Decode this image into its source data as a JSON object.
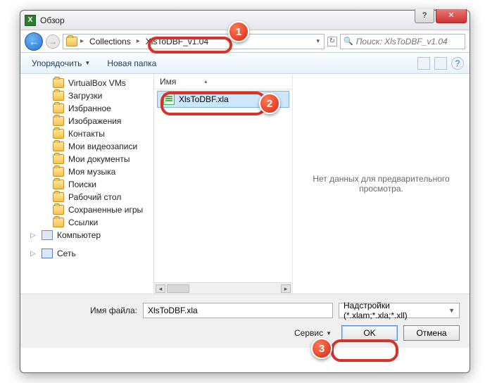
{
  "window": {
    "title": "Обзор"
  },
  "nav": {
    "crumb1": "Collections",
    "crumb2": "XlsToDBF_v1.04",
    "search_placeholder": "Поиск: XlsToDBF_v1.04"
  },
  "toolbar": {
    "organize": "Упорядочить",
    "newfolder": "Новая папка"
  },
  "sidebar": {
    "items": [
      "VirtualBox VMs",
      "Загрузки",
      "Избранное",
      "Изображения",
      "Контакты",
      "Мои видеозаписи",
      "Мои документы",
      "Моя музыка",
      "Поиски",
      "Рабочий стол",
      "Сохраненные игры",
      "Ссылки"
    ],
    "computer": "Компьютер",
    "network": "Сеть"
  },
  "filelist": {
    "col_name": "Имя",
    "file1": "XlsToDBF.xla"
  },
  "preview": {
    "text": "Нет данных для предварительного просмотра."
  },
  "footer": {
    "filename_label": "Имя файла:",
    "filename_value": "XlsToDBF.xla",
    "filter": "Надстройки (*.xlam;*.xla;*.xll)",
    "service": "Сервис",
    "ok": "OK",
    "cancel": "Отмена"
  },
  "callouts": {
    "c1": "1",
    "c2": "2",
    "c3": "3"
  }
}
